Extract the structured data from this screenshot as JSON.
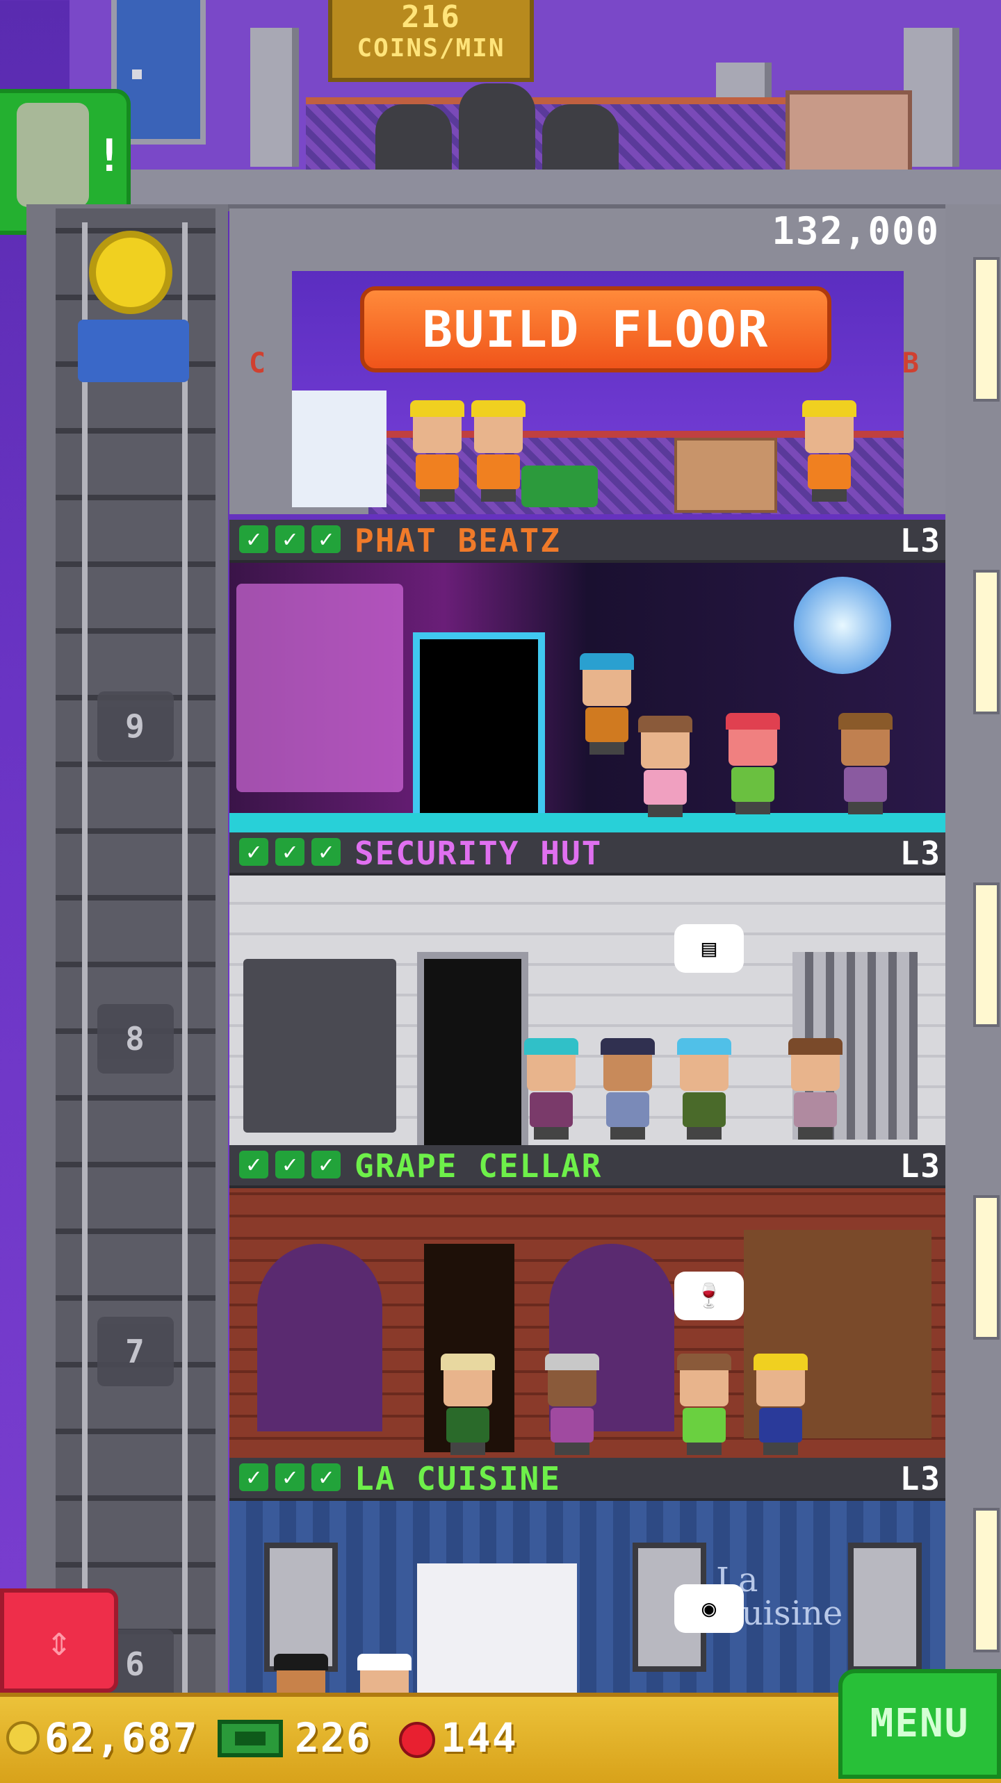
{
  "rooftop": {
    "coins_value": "216",
    "coins_unit": "COINS/MIN"
  },
  "build_floor": {
    "cost": "132,000",
    "button_label": "BUILD FLOOR",
    "left_letter": "C",
    "right_letter": "B"
  },
  "floors": [
    {
      "name": "PHAT BEATZ",
      "level": "L3",
      "name_color": "#f07a2a",
      "shaft_number": "9"
    },
    {
      "name": "SECURITY HUT",
      "level": "L3",
      "name_color": "#e070f0",
      "shaft_number": "8"
    },
    {
      "name": "GRAPE CELLAR",
      "level": "L3",
      "name_color": "#6ef04a",
      "shaft_number": "7"
    },
    {
      "name": "LA CUISINE",
      "level": "L3",
      "name_color": "#6ef04a",
      "shaft_number": "6"
    }
  ],
  "cellar_sign": "La Cuisine",
  "hud": {
    "coins": "62,687",
    "bux": "226",
    "gems": "144",
    "menu_label": "MENU"
  },
  "colors": {
    "sky": "#6a34c4",
    "hud": "#e0b028",
    "menu_green": "#28c038",
    "build_orange": "#f06a24"
  },
  "icons": {
    "zombie": "zombie-visitor-icon",
    "coin": "coin-icon",
    "bux": "tower-bux-icon",
    "gem": "gem-icon",
    "elevator_toggle": "up-down-arrows-icon"
  }
}
